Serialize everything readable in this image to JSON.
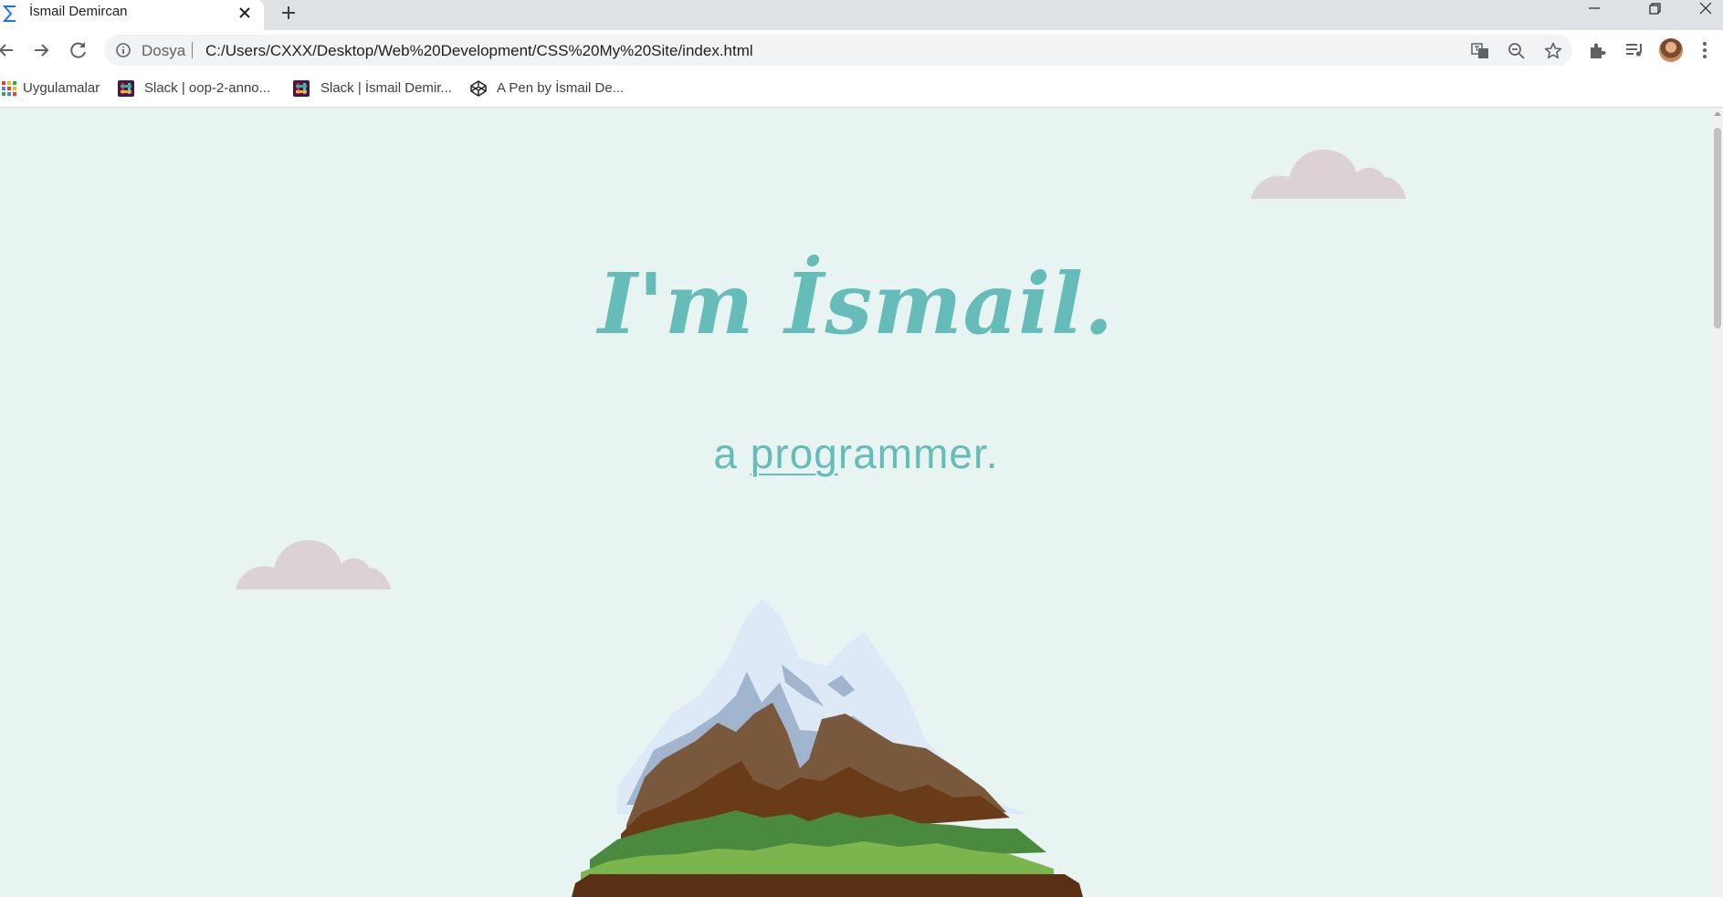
{
  "browser": {
    "tab": {
      "title": "İsmail Demircan"
    },
    "address_bar": {
      "security_label": "Dosya",
      "url": "C:/Users/CXXX/Desktop/Web%20Development/CSS%20My%20Site/index.html"
    },
    "bookmarks": [
      {
        "label": "Uygulamalar",
        "icon": "apps-grid-icon"
      },
      {
        "label": "Slack | oop-2-anno...",
        "icon": "slack-icon"
      },
      {
        "label": "Slack | İsmail Demir...",
        "icon": "slack-icon"
      },
      {
        "label": "A Pen by İsmail De...",
        "icon": "codepen-icon"
      }
    ]
  },
  "page": {
    "headline": "I'm İsmail.",
    "subtitle_prefix": "a ",
    "subtitle_link": "prog",
    "subtitle_suffix": "rammer."
  },
  "colors": {
    "page_background": "#e8f4f2",
    "heading_teal": "#66bcb9",
    "cloud": "#dbd1d6"
  }
}
